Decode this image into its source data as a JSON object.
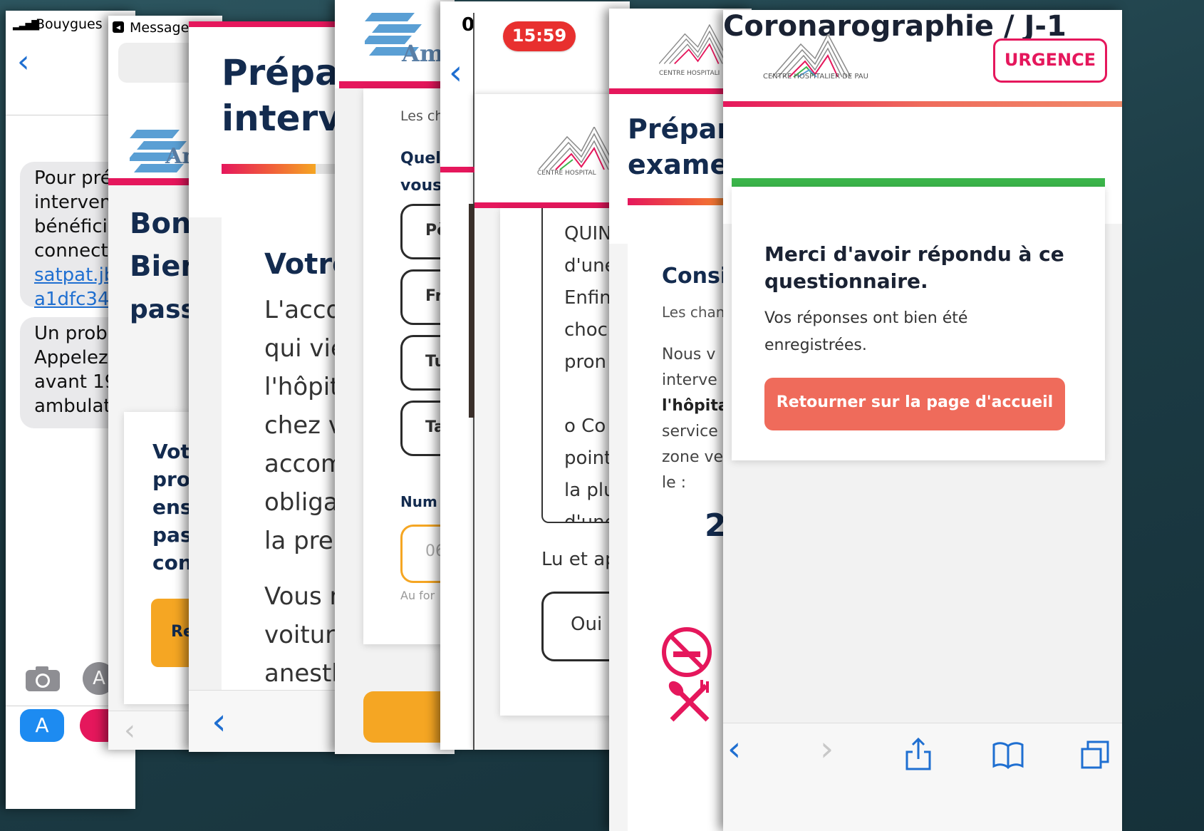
{
  "colors": {
    "pink": "#e5175c",
    "orange": "#f5a623",
    "blue_link": "#1f6fd1",
    "navy": "#132b4f",
    "green": "#3bb54a",
    "coral": "#ef6b5b"
  },
  "p1": {
    "carrier": "Bouygues",
    "bubble1_lines": [
      "Pour pré",
      "intervent",
      "bénéficie",
      "connecte"
    ],
    "bubble1_links": [
      "satpat.jb",
      "a1dfc34"
    ],
    "bubble2_lines": [
      "Un probl",
      "Appelez",
      "avant 19",
      "ambulato"
    ]
  },
  "p2": {
    "back_app": "Messages",
    "logo_text": "An",
    "heading_lines": [
      "Bon",
      "Bien"
    ],
    "heading_line3": "pass",
    "card_lines": [
      "Vot",
      "pro",
      "ens",
      "pas",
      "con"
    ],
    "button_label": "Re"
  },
  "p3": {
    "title_lines": [
      "Prépar",
      "interv"
    ],
    "section_title": "Votre",
    "body_lines": [
      "L'acco",
      "qui vie",
      "l'hôpit",
      "chez v",
      "accom",
      "obliga",
      "la pren"
    ],
    "body_lines2": [
      "Vous r",
      "voiture",
      "anesth"
    ]
  },
  "p4": {
    "logo_text": "Am",
    "small_text": "Les ch",
    "question_lines": [
      "Quel",
      "vous"
    ],
    "options": [
      "Pè",
      "Fr",
      "Tu",
      "Ta"
    ],
    "num_label": "Num",
    "phone_placeholder": "06",
    "hint": "Au for"
  },
  "p5": {
    "time_partial": "0",
    "logo_caption": "CENTRE HOSPITAL",
    "text_lines": [
      "QUIN",
      "d'une",
      "Enfin",
      "choc",
      "pron"
    ],
    "text_lines2": [
      "o Co",
      "point",
      "la plu",
      "d'une"
    ],
    "lu_label": "Lu et ap",
    "oui_label": "Oui"
  },
  "p6": {
    "time": "15:59",
    "logo_caption": "CENTRE HOSPITALI",
    "title_lines": [
      "Prépar",
      "exame"
    ],
    "section_title": "Consi",
    "small_text": "Les chan",
    "body_lines": [
      "Nous v",
      "interve",
      "l'hôpita",
      "service",
      "zone ve",
      "le :"
    ],
    "big_digit": "2"
  },
  "p7": {
    "logo_caption": "CENTRE HOSPITALIER DE PAU",
    "urgence": "URGENCE",
    "title": "Coronarographie / J-1",
    "thanks_line1": "Merci d'avoir répondu à ce",
    "thanks_line2": "questionnaire.",
    "saved_line1": "Vos réponses ont bien été",
    "saved_line2": "enregistrées.",
    "home_button": "Retourner sur la page d'accueil"
  }
}
